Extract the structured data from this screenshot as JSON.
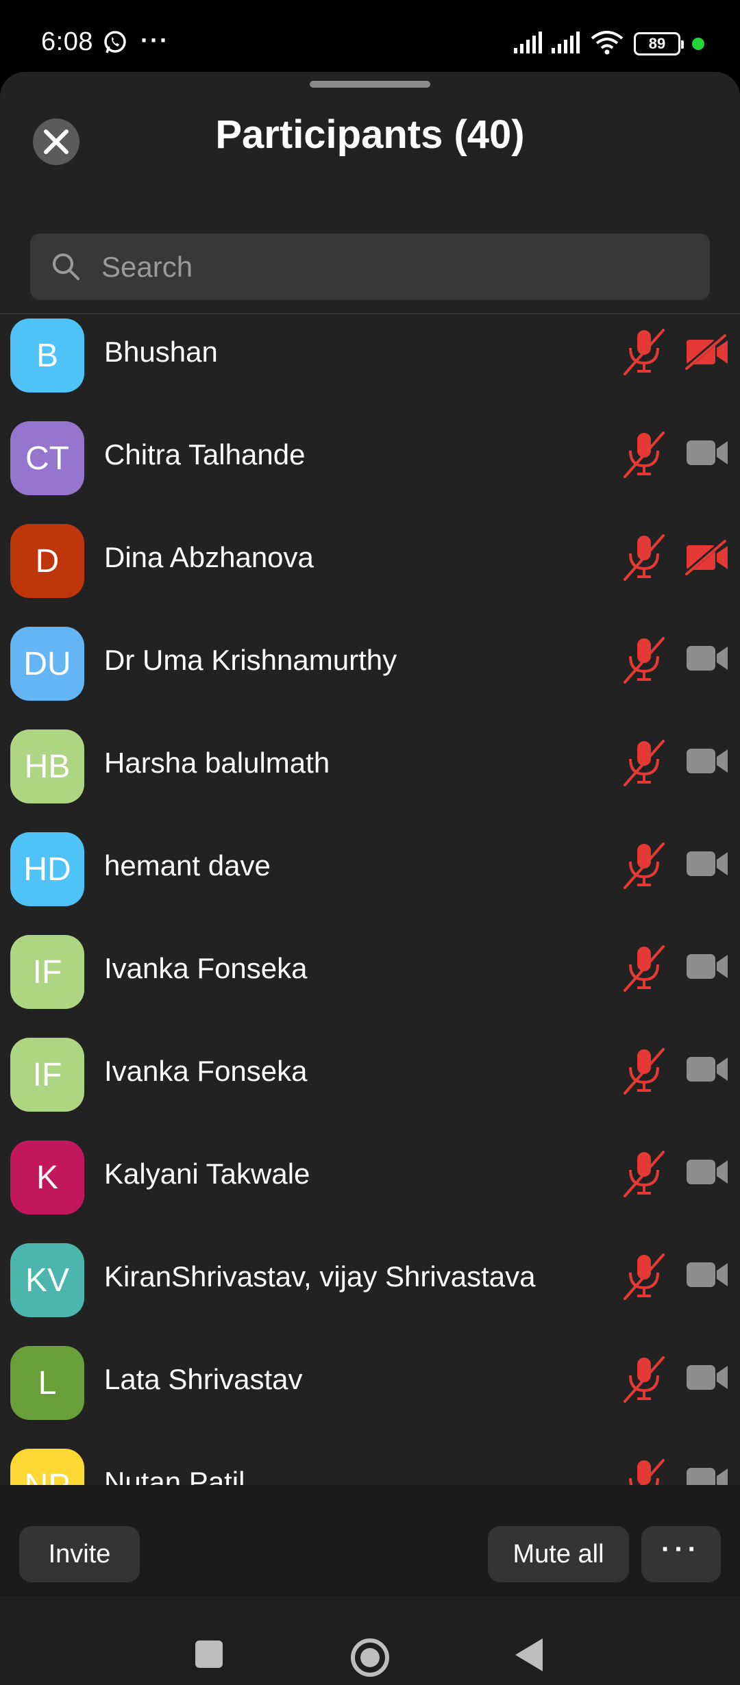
{
  "status_bar": {
    "time": "6:08",
    "more_dots": "···",
    "battery": "89",
    "icons": [
      "whatsapp-icon",
      "signal-icon",
      "signal-icon",
      "wifi-icon",
      "battery-icon"
    ]
  },
  "header": {
    "title": "Participants (40)",
    "close_icon": "close-icon"
  },
  "search": {
    "placeholder": "Search",
    "value": ""
  },
  "participants": [
    {
      "initials": "B",
      "name": "Bhushan",
      "color": "#4fc3f7",
      "muted": true,
      "video_off": true
    },
    {
      "initials": "CT",
      "name": "Chitra Talhande",
      "color": "#9575cd",
      "muted": true,
      "video_off": false
    },
    {
      "initials": "D",
      "name": "Dina Abzhanova",
      "color": "#bf360c",
      "muted": true,
      "video_off": true
    },
    {
      "initials": "DU",
      "name": "Dr Uma Krishnamurthy",
      "color": "#64b5f6",
      "muted": true,
      "video_off": false
    },
    {
      "initials": "HB",
      "name": "Harsha balulmath",
      "color": "#aed581",
      "muted": true,
      "video_off": false
    },
    {
      "initials": "HD",
      "name": "hemant dave",
      "color": "#4fc3f7",
      "muted": true,
      "video_off": false
    },
    {
      "initials": "IF",
      "name": "Ivanka Fonseka",
      "color": "#aed581",
      "muted": true,
      "video_off": false
    },
    {
      "initials": "IF",
      "name": "Ivanka Fonseka",
      "color": "#aed581",
      "muted": true,
      "video_off": false
    },
    {
      "initials": "K",
      "name": "Kalyani Takwale",
      "color": "#c2185b",
      "muted": true,
      "video_off": false
    },
    {
      "initials": "KV",
      "name": "KiranShrivastav, vijay Shrivastava",
      "color": "#4db6ac",
      "muted": true,
      "video_off": false
    },
    {
      "initials": "L",
      "name": "Lata Shrivastav",
      "color": "#689f38",
      "muted": true,
      "video_off": false
    },
    {
      "initials": "NP",
      "name": "Nutan Patil",
      "color": "#fdd835",
      "muted": true,
      "video_off": false
    }
  ],
  "footer": {
    "invite_label": "Invite",
    "mute_all_label": "Mute all",
    "more_label": "···"
  },
  "colors": {
    "muted_red": "#e53935",
    "camera_gray": "#8e8e8e",
    "sheet_bg": "#222222"
  }
}
